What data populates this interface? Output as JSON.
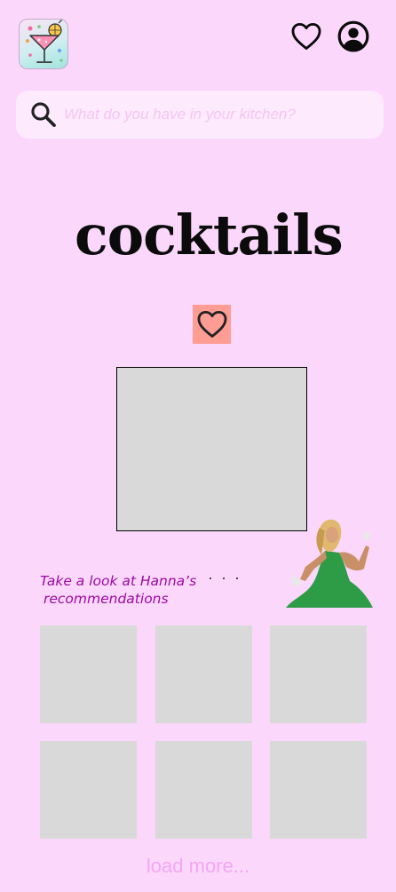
{
  "header": {
    "logo_icon": "cocktail-logo-icon",
    "favorites_icon": "heart-outline-icon",
    "profile_icon": "user-circle-icon"
  },
  "search": {
    "placeholder": "What do you have in your kitchen?",
    "value": "",
    "icon": "search-icon"
  },
  "main": {
    "title": "cocktails",
    "favorite_icon": "heart-outline-icon",
    "favorite_bg_color": "#ff9d94"
  },
  "recommendations": {
    "label_line1": "Take a look at Hanna’s",
    "label_line2": "recommendations",
    "more_dots": "· · ·",
    "tiles": [
      "",
      "",
      "",
      "",
      "",
      ""
    ]
  },
  "footer": {
    "load_more": "load more..."
  },
  "colors": {
    "background": "#fbd8fb",
    "search_bg": "#fdeafd",
    "accent_text": "#9c0aa0",
    "placeholder": "#d9d9d9"
  }
}
